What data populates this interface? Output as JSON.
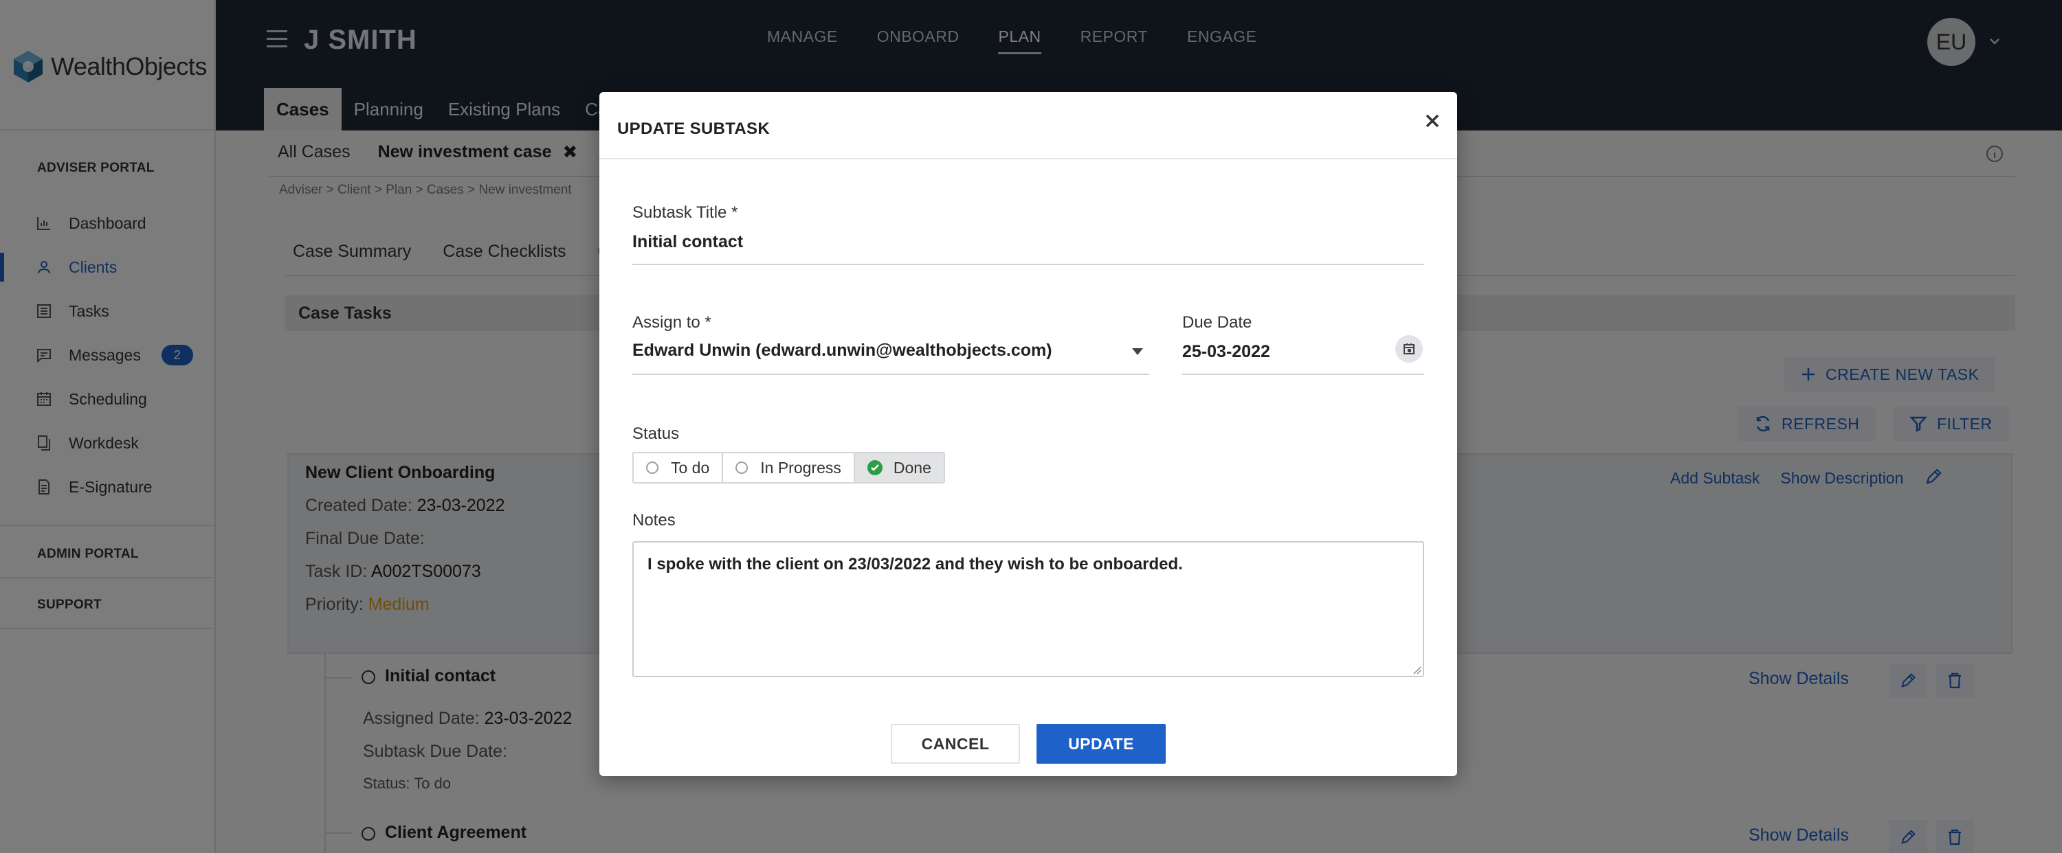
{
  "brand": {
    "name": "WealthObjects"
  },
  "sidebar": {
    "sections": {
      "adviser": "ADVISER PORTAL",
      "admin": "ADMIN PORTAL",
      "support": "SUPPORT"
    },
    "items": [
      {
        "label": "Dashboard",
        "icon": "bar-chart-icon"
      },
      {
        "label": "Clients",
        "icon": "user-icon"
      },
      {
        "label": "Tasks",
        "icon": "list-icon"
      },
      {
        "label": "Messages",
        "icon": "message-icon",
        "badge": "2"
      },
      {
        "label": "Scheduling",
        "icon": "calendar-icon"
      },
      {
        "label": "Workdesk",
        "icon": "documents-icon"
      },
      {
        "label": "E-Signature",
        "icon": "signature-doc-icon"
      }
    ]
  },
  "header": {
    "client_name": "J SMITH",
    "nav": [
      "MANAGE",
      "ONBOARD",
      "PLAN",
      "REPORT",
      "ENGAGE"
    ],
    "nav_active": "PLAN",
    "avatar_initials": "EU",
    "subtabs": [
      "Cases",
      "Planning",
      "Existing Plans",
      "Cash"
    ]
  },
  "main": {
    "case_tabs": {
      "all": "All Cases",
      "current": "New investment case",
      "close": "✖"
    },
    "breadcrumb": "Adviser  >  Client  >  Plan  >  Cases  >  New investment",
    "section_tabs": [
      "Case Summary",
      "Case Checklists",
      "C"
    ],
    "case_tasks_title": "Case Tasks",
    "buttons": {
      "create_task": "CREATE NEW TASK",
      "refresh": "REFRESH",
      "filter": "FILTER"
    },
    "task": {
      "title": "New Client Onboarding",
      "created_label": "Created Date:",
      "created_value": "23-03-2022",
      "final_due_label": "Final Due Date:",
      "task_id_label": "Task ID:",
      "task_id_value": "A002TS00073",
      "priority_label": "Priority:",
      "priority_value": "Medium",
      "add_subtask": "Add Subtask",
      "show_description": "Show Description"
    },
    "subtasks": [
      {
        "title": "Initial contact",
        "assigned_label": "Assigned Date:",
        "assigned_value": "23-03-2022",
        "due_label": "Subtask Due Date:",
        "status_label": "Status:",
        "status_value": "To do",
        "details": "Show Details"
      },
      {
        "title": "Client Agreement",
        "details": "Show Details"
      }
    ]
  },
  "modal": {
    "title": "UPDATE SUBTASK",
    "close": "✕",
    "subtask_title_label": "Subtask Title *",
    "subtask_title_value": "Initial contact",
    "assign_label": "Assign to *",
    "assign_value": "Edward Unwin (edward.unwin@wealthobjects.com)",
    "due_label": "Due Date",
    "due_value": "25-03-2022",
    "status_label": "Status",
    "status_options": [
      "To do",
      "In Progress",
      "Done"
    ],
    "status_selected": "Done",
    "notes_label": "Notes",
    "notes_value": "I spoke with the client on 23/03/2022 and they wish to be onboarded.",
    "cancel": "CANCEL",
    "update": "UPDATE"
  },
  "colors": {
    "accent": "#1e5fbf",
    "header_bg": "#1f2837",
    "priority_medium": "#e39a12",
    "done_green": "#2e9e44"
  }
}
